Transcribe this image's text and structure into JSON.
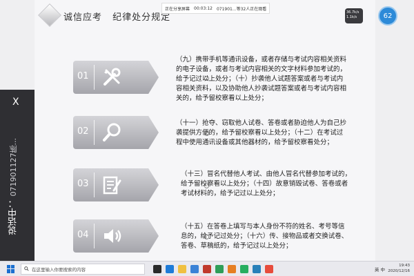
{
  "header": {
    "title_part1": "诚信应考",
    "title_part2": "纪律处分规定"
  },
  "status_bar": {
    "item1": "正在分享屏幕",
    "time": "00:03:12",
    "item2": "071901...等32人正在观看"
  },
  "rows": [
    {
      "num": "01",
      "icon": "tools-icon"
    },
    {
      "num": "02",
      "icon": "magnifier-icon"
    },
    {
      "num": "03",
      "icon": "document-edit-icon"
    },
    {
      "num": "04",
      "icon": "speaker-icon"
    }
  ],
  "texts": {
    "t1": "（九）携带手机等通讯设备，或者存储与考试内容相关资料的电子设备，或者与考试内容相关的文字材料参加考试的，给予记过以上处分；（十）抄袭他人试题答案或者与考试内容相关资料，以及协助他人抄袭试题答案或者与考试内容相关的，给予留校察看以上处分；",
    "t2": "（十一）抢夺、窃取他人试卷、答卷或者胁迫他人为自己抄袭提供方便的，给予留校察看以上处分；（十二）在考试过程中使用通讯设备或其他器材的，给予留校察看处分；",
    "t3": "（十三）冒名代替他人考试、由他人冒名代替参加考试的，给予留校察看以上处分；（十四）故意销毁试卷、答卷或者考试材料的，给予记过以上处分；",
    "t4": "（十五）在答卷上填写与本人身份不符的姓名、考号等信息的，给予记过处分；（十六）传、接物品或者交换试卷、答卷、草稿纸的，给予记过以上处分；"
  },
  "chat": {
    "close": "X",
    "label": "说话中：",
    "speaker": "071901127陈..."
  },
  "widgets": {
    "net_up": "36.7k/s",
    "net_down": "1.1k/s",
    "battery": "62"
  },
  "taskbar": {
    "search_placeholder": "在这里输入你要搜索的内容",
    "ime": "英 中",
    "time": "19:43",
    "date": "2020/12/16"
  },
  "colors": {
    "tab_top": "#d4d4d8",
    "tab_bottom": "#a5a5ab",
    "accent": "#2d8ad8",
    "chat_bg": "#2f2f33"
  }
}
